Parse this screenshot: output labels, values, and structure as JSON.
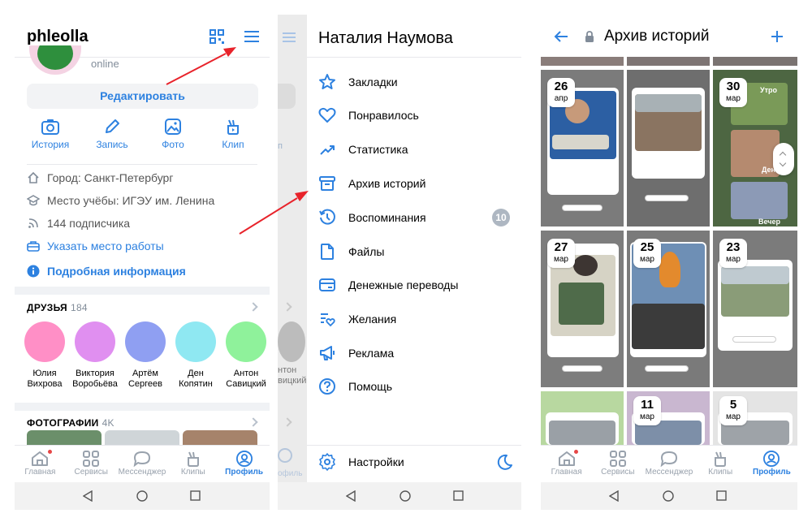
{
  "profile": {
    "username": "phleolla",
    "status": "online",
    "edit_label": "Редактировать",
    "actions": [
      {
        "label": "История",
        "icon": "camera-icon"
      },
      {
        "label": "Запись",
        "icon": "pencil-icon"
      },
      {
        "label": "Фото",
        "icon": "photo-icon"
      },
      {
        "label": "Клип",
        "icon": "clip-icon"
      }
    ],
    "info": {
      "city": "Город: Санкт-Петербург",
      "study": "Место учёбы: ИГЭУ им. Ленина",
      "subscribers": "144 подписчика",
      "work_link": "Указать место работы",
      "details_link": "Подробная информация"
    },
    "friends_title": "ДРУЗЬЯ",
    "friends_count": "184",
    "friends": [
      {
        "first": "Юлия",
        "last": "Вихрова",
        "color": "#ff8fc6"
      },
      {
        "first": "Виктория",
        "last": "Воробьёва",
        "color": "#e08ff0"
      },
      {
        "first": "Артём",
        "last": "Сергеев",
        "color": "#8f9ff2"
      },
      {
        "first": "Ден",
        "last": "Копятин",
        "color": "#8fe8f2"
      },
      {
        "first": "Антон",
        "last": "Савицкий",
        "color": "#8ff29b"
      }
    ],
    "photos_title": "ФОТОГРАФИИ",
    "photos_count": "4K"
  },
  "tabbar": {
    "tabs": [
      {
        "label": "Главная"
      },
      {
        "label": "Сервисы"
      },
      {
        "label": "Мессенджер"
      },
      {
        "label": "Клипы"
      },
      {
        "label": "Профиль"
      }
    ]
  },
  "menu": {
    "user_name": "Наталия Наумова",
    "items": [
      {
        "label": "Закладки",
        "icon": "star-icon"
      },
      {
        "label": "Понравилось",
        "icon": "heart-icon"
      },
      {
        "label": "Статистика",
        "icon": "stats-icon"
      },
      {
        "label": "Архив историй",
        "icon": "archive-icon"
      },
      {
        "label": "Воспоминания",
        "icon": "memories-icon",
        "badge": "10"
      },
      {
        "label": "Файлы",
        "icon": "file-icon"
      },
      {
        "label": "Денежные переводы",
        "icon": "money-icon"
      },
      {
        "label": "Желания",
        "icon": "wishes-icon"
      },
      {
        "label": "Реклама",
        "icon": "megaphone-icon"
      },
      {
        "label": "Помощь",
        "icon": "help-icon"
      }
    ],
    "settings_label": "Настройки",
    "peek_text_1": "п",
    "peek_name_1": "нтон",
    "peek_name_2": "вицкий",
    "peek_tab": "офиль"
  },
  "archive": {
    "title": "Архив историй",
    "dates": [
      {
        "day": "26",
        "month": "апр"
      },
      {
        "day": "30",
        "month": "мар"
      },
      {
        "day": "27",
        "month": "мар"
      },
      {
        "day": "25",
        "month": "мар"
      },
      {
        "day": "23",
        "month": "мар"
      },
      {
        "day": "11",
        "month": "мар"
      },
      {
        "day": "5",
        "month": "мар"
      }
    ],
    "labels": {
      "morning": "Утро",
      "day": "День",
      "evening": "Вечер"
    }
  },
  "colors": {
    "accent": "#2d81e0",
    "arrow": "#e8232b",
    "badge": "#aeb7c2"
  }
}
